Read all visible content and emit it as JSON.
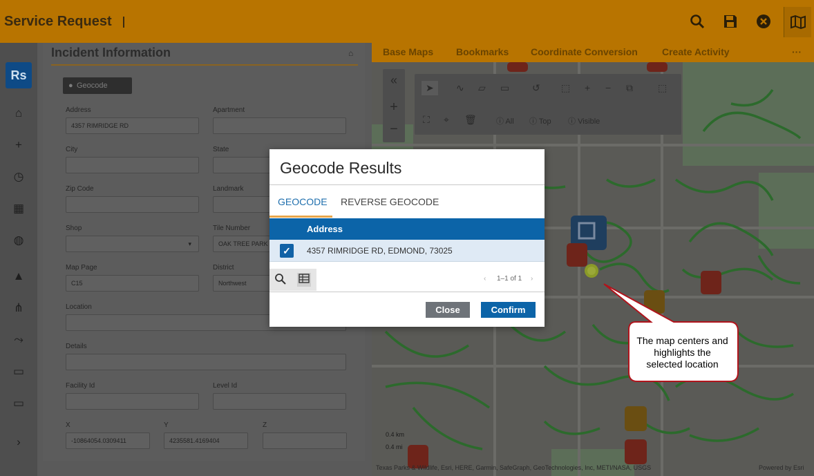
{
  "appbar": {
    "title": "Service Request",
    "icons": [
      "search-icon",
      "save-icon",
      "close-circle-icon",
      "map-icon"
    ]
  },
  "rail": {
    "logo": "Rs",
    "items": [
      "home-icon",
      "add-icon",
      "history-icon",
      "grid-icon",
      "globe-icon",
      "bell-icon",
      "network-icon",
      "route-icon",
      "video-icon",
      "video-icon",
      "chevron-right-icon"
    ]
  },
  "form": {
    "title": "Incident Information",
    "geocode_label": "Geocode",
    "labels": {
      "address": "Address",
      "apartment": "Apartment",
      "city": "City",
      "state": "State",
      "zip": "Zip Code",
      "landmark": "Landmark",
      "shop": "Shop",
      "tile": "Tile Number",
      "map_page": "Map Page",
      "district": "District",
      "location": "Location",
      "details": "Details",
      "facility": "Facility Id",
      "level": "Level Id",
      "x": "X",
      "y": "Y",
      "z": "Z"
    },
    "values": {
      "address": "4357 RIMRIDGE RD",
      "tile": "OAK TREE PARK",
      "map_page": "C15",
      "district": "Northwest",
      "x": "-10864054.0309411",
      "y": "4235581.4169404"
    }
  },
  "map": {
    "tabs": [
      "Base Maps",
      "Bookmarks",
      "Coordinate Conversion",
      "Create Activity"
    ],
    "tools_row2": [
      "All",
      "Top",
      "Visible"
    ],
    "scale": [
      "0.4 km",
      "0.4 mi"
    ],
    "attribution": "Texas Parks & Wildlife, Esri, HERE, Garmin, SafeGraph, GeoTechnologies, Inc, METI/NASA, USGS",
    "powered": "Powered by Esri"
  },
  "dialog": {
    "title": "Geocode Results",
    "tabs": [
      "GEOCODE",
      "REVERSE GEOCODE"
    ],
    "column": "Address",
    "row": "4357 RIMRIDGE RD, EDMOND, 73025",
    "pager": "1–1 of 1",
    "close_label": "Close",
    "confirm_label": "Confirm"
  },
  "callout": {
    "line1": "The map centers and",
    "line2": "highlights the",
    "line3": "selected location"
  },
  "colors": {
    "accent": "#f29b00",
    "primary": "#0c64a8",
    "callout_border": "#b0141c"
  }
}
